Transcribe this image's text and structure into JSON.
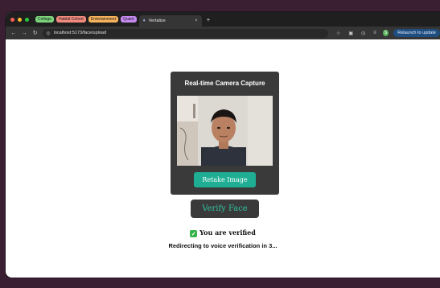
{
  "browser": {
    "tab_groups": [
      {
        "label": "College",
        "color": "#7cd47c"
      },
      {
        "label": "Habbit Cohort",
        "color": "#f08a7e"
      },
      {
        "label": "Entertainment",
        "color": "#f5b25c"
      },
      {
        "label": "Quant",
        "color": "#c58af0"
      }
    ],
    "active_tab": {
      "title": "Vertalize",
      "close": "×"
    },
    "new_tab": "+",
    "url": "localhost:5173/face/upload",
    "relaunch_label": "Relaunch to update",
    "profile_initial": "S"
  },
  "page": {
    "card_title": "Real-time Camera Capture",
    "retake_label": "Retake Image",
    "verify_label": "Verify Face",
    "verified_text": "You are verified",
    "redirect_text": "Redirecting to voice verification in 3..."
  },
  "colors": {
    "accent": "#1fae94",
    "card_bg": "#3a3a3a",
    "verify_text": "#2fc49f",
    "check_green": "#36b24a"
  },
  "icons": {
    "back": "back-arrow-icon",
    "forward": "forward-arrow-icon",
    "reload": "reload-icon",
    "site_info": "site-info-icon",
    "bookmark": "star-icon",
    "extensions": "puzzle-icon",
    "check": "check-icon"
  }
}
